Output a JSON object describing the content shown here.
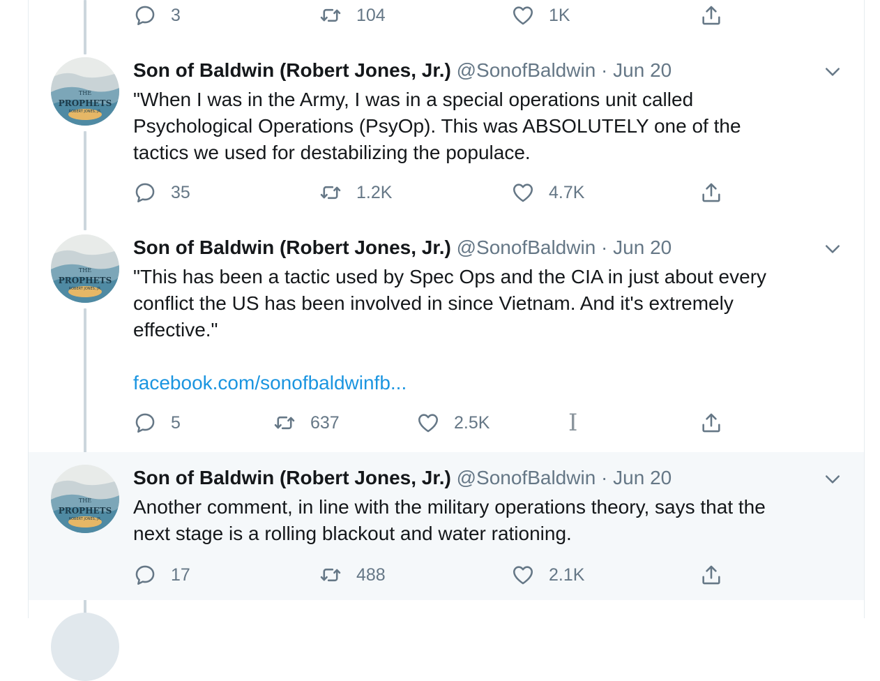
{
  "prev_tweet": {
    "replies": "3",
    "retweets": "104",
    "likes": "1K"
  },
  "tweets": [
    {
      "name": "Son of Baldwin (Robert Jones, Jr.)",
      "handle": "@SonofBaldwin",
      "separator": "·",
      "date": "Jun 20",
      "avatar_text": [
        "THE",
        "PROPHETS",
        "ROBERT JONES, JR."
      ],
      "text": "\"When I was in the Army, I was in a special operations unit called\nPsychological Operations (PsyOp). This was ABSOLUTELY one of the\ntactics we used for destabilizing the populace.",
      "replies": "35",
      "retweets": "1.2K",
      "likes": "4.7K"
    },
    {
      "name": "Son of Baldwin (Robert Jones, Jr.)",
      "handle": "@SonofBaldwin",
      "separator": "·",
      "date": "Jun 20",
      "avatar_text": [
        "THE",
        "PROPHETS",
        "ROBERT JONES, JR."
      ],
      "text": "\"This has been a tactic used by Spec Ops and the CIA in just about every\nconflict the US has been involved in since Vietnam. And it's extremely\neffective.\"",
      "link": "facebook.com/sonofbaldwinfb...",
      "replies": "5",
      "retweets": "637",
      "likes": "2.5K",
      "cursor": "I"
    },
    {
      "name": "Son of Baldwin (Robert Jones, Jr.)",
      "handle": "@SonofBaldwin",
      "separator": "·",
      "date": "Jun 20",
      "avatar_text": [
        "THE",
        "PROPHETS",
        "ROBERT JONES, JR."
      ],
      "text": "Another comment, in line with the military operations theory, says that the\nnext stage is a rolling blackout and water rationing.",
      "replies": "17",
      "retweets": "488",
      "likes": "2.1K",
      "highlighted": true
    }
  ],
  "icons": {
    "reply": "reply-icon",
    "retweet": "retweet-icon",
    "like": "heart-icon",
    "share": "share-icon",
    "caret": "chevron-down-icon"
  },
  "colors": {
    "text": "#14171a",
    "secondary": "#657786",
    "link": "#1b95e0",
    "thread_line": "#ccd6dd",
    "highlight_bg": "#f5f8fa"
  }
}
